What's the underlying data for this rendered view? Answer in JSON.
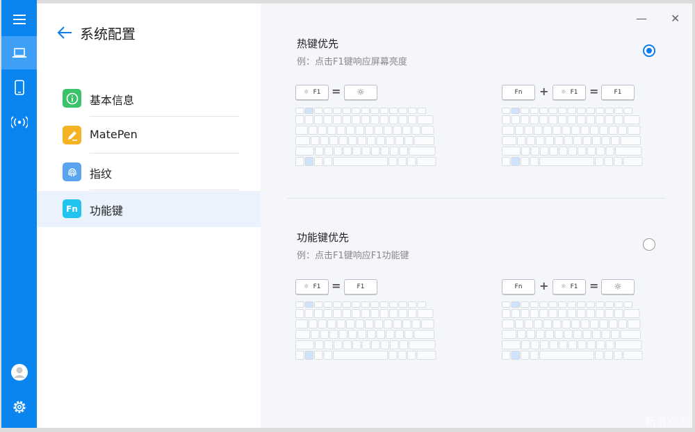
{
  "rail": {
    "items": [
      "menu-icon",
      "laptop-icon",
      "phone-icon",
      "wireless-icon"
    ],
    "bottom": [
      "avatar",
      "settings-icon"
    ]
  },
  "sidebar": {
    "title": "系统配置",
    "items": [
      {
        "label": "基本信息",
        "icon": "info-icon",
        "color": "#3bc26a"
      },
      {
        "label": "MatePen",
        "icon": "pen-icon",
        "color": "#f5b324"
      },
      {
        "label": "指纹",
        "icon": "fingerprint-icon",
        "color": "#5aa4ef"
      },
      {
        "label": "功能键",
        "icon": "fn-icon",
        "icon_text": "Fn",
        "color": "#20c4ee"
      }
    ]
  },
  "sections": [
    {
      "title": "热键优先",
      "example": "例：点击F1键响应屏幕亮度",
      "selected": true,
      "left": {
        "key_label": "F1",
        "result": "brightness"
      },
      "right": {
        "fn": "Fn",
        "key_label": "F1",
        "result_text": "F1"
      }
    },
    {
      "title": "功能键优先",
      "example": "例：点击F1键响应F1功能键",
      "selected": false,
      "left": {
        "key_label": "F1",
        "result_text": "F1"
      },
      "right": {
        "fn": "Fn",
        "key_label": "F1",
        "result": "brightness"
      }
    }
  ],
  "ops": {
    "equals": "=",
    "plus": "+"
  },
  "window": {
    "minimize": "—",
    "close": "✕"
  },
  "watermark": "新浪众测",
  "colors": {
    "accent": "#0a85f0",
    "rail": "#0a85f0",
    "content_bg": "#f4f6fa"
  }
}
